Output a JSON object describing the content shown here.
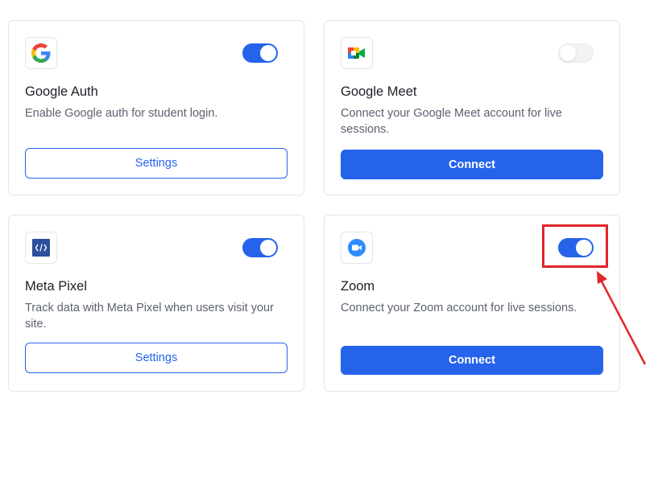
{
  "cards": [
    {
      "title": "Google Auth",
      "description": "Enable Google auth for student login.",
      "button_label": "Settings",
      "button_style": "outline",
      "toggle": "on",
      "icon": "google-logo-icon"
    },
    {
      "title": "Google Meet",
      "description": "Connect your Google Meet account for live sessions.",
      "button_label": "Connect",
      "button_style": "solid",
      "toggle": "off",
      "icon": "google-meet-icon"
    },
    {
      "title": "Meta Pixel",
      "description": "Track data with Meta Pixel when users visit your site.",
      "button_label": "Settings",
      "button_style": "outline",
      "toggle": "on",
      "icon": "code-icon"
    },
    {
      "title": "Zoom",
      "description": "Connect your Zoom account for live sessions.",
      "button_label": "Connect",
      "button_style": "solid",
      "toggle": "on",
      "icon": "zoom-icon"
    }
  ],
  "colors": {
    "accent": "#2563eb",
    "annotation": "#e0262b",
    "border": "#e3e5ea"
  },
  "annotation": {
    "target": "zoom-toggle",
    "shape": "rectangle-with-arrow"
  }
}
